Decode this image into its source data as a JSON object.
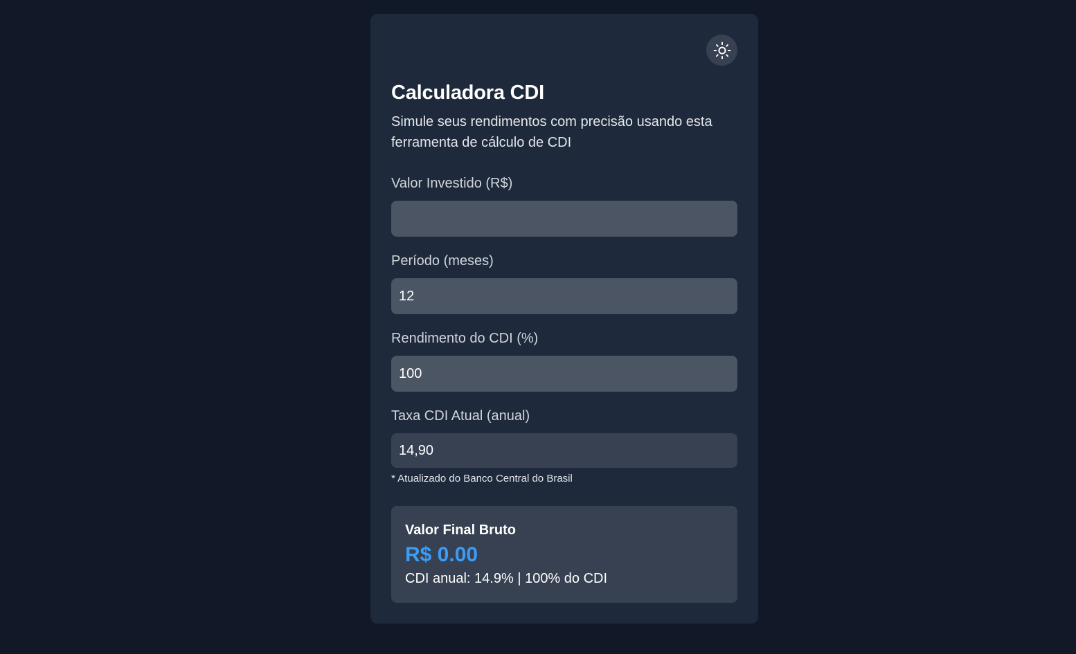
{
  "theme": {
    "toggle_icon": "sun-icon",
    "background": "#111827",
    "card_background": "#1e293b",
    "accent": "#3b9cf6"
  },
  "header": {
    "title": "Calculadora CDI",
    "subtitle": "Simule seus rendimentos com precisão usando esta ferramenta de cálculo de CDI"
  },
  "form": {
    "invested": {
      "label": "Valor Investido (R$)",
      "value": ""
    },
    "period": {
      "label": "Período (meses)",
      "value": "12"
    },
    "cdi_yield": {
      "label": "Rendimento do CDI (%)",
      "value": "100"
    },
    "cdi_rate": {
      "label": "Taxa CDI Atual (anual)",
      "value": "14,90",
      "note": "* Atualizado do Banco Central do Brasil"
    }
  },
  "result": {
    "title": "Valor Final Bruto",
    "value": "R$ 0.00",
    "info": "CDI anual: 14.9% | 100% do CDI"
  }
}
